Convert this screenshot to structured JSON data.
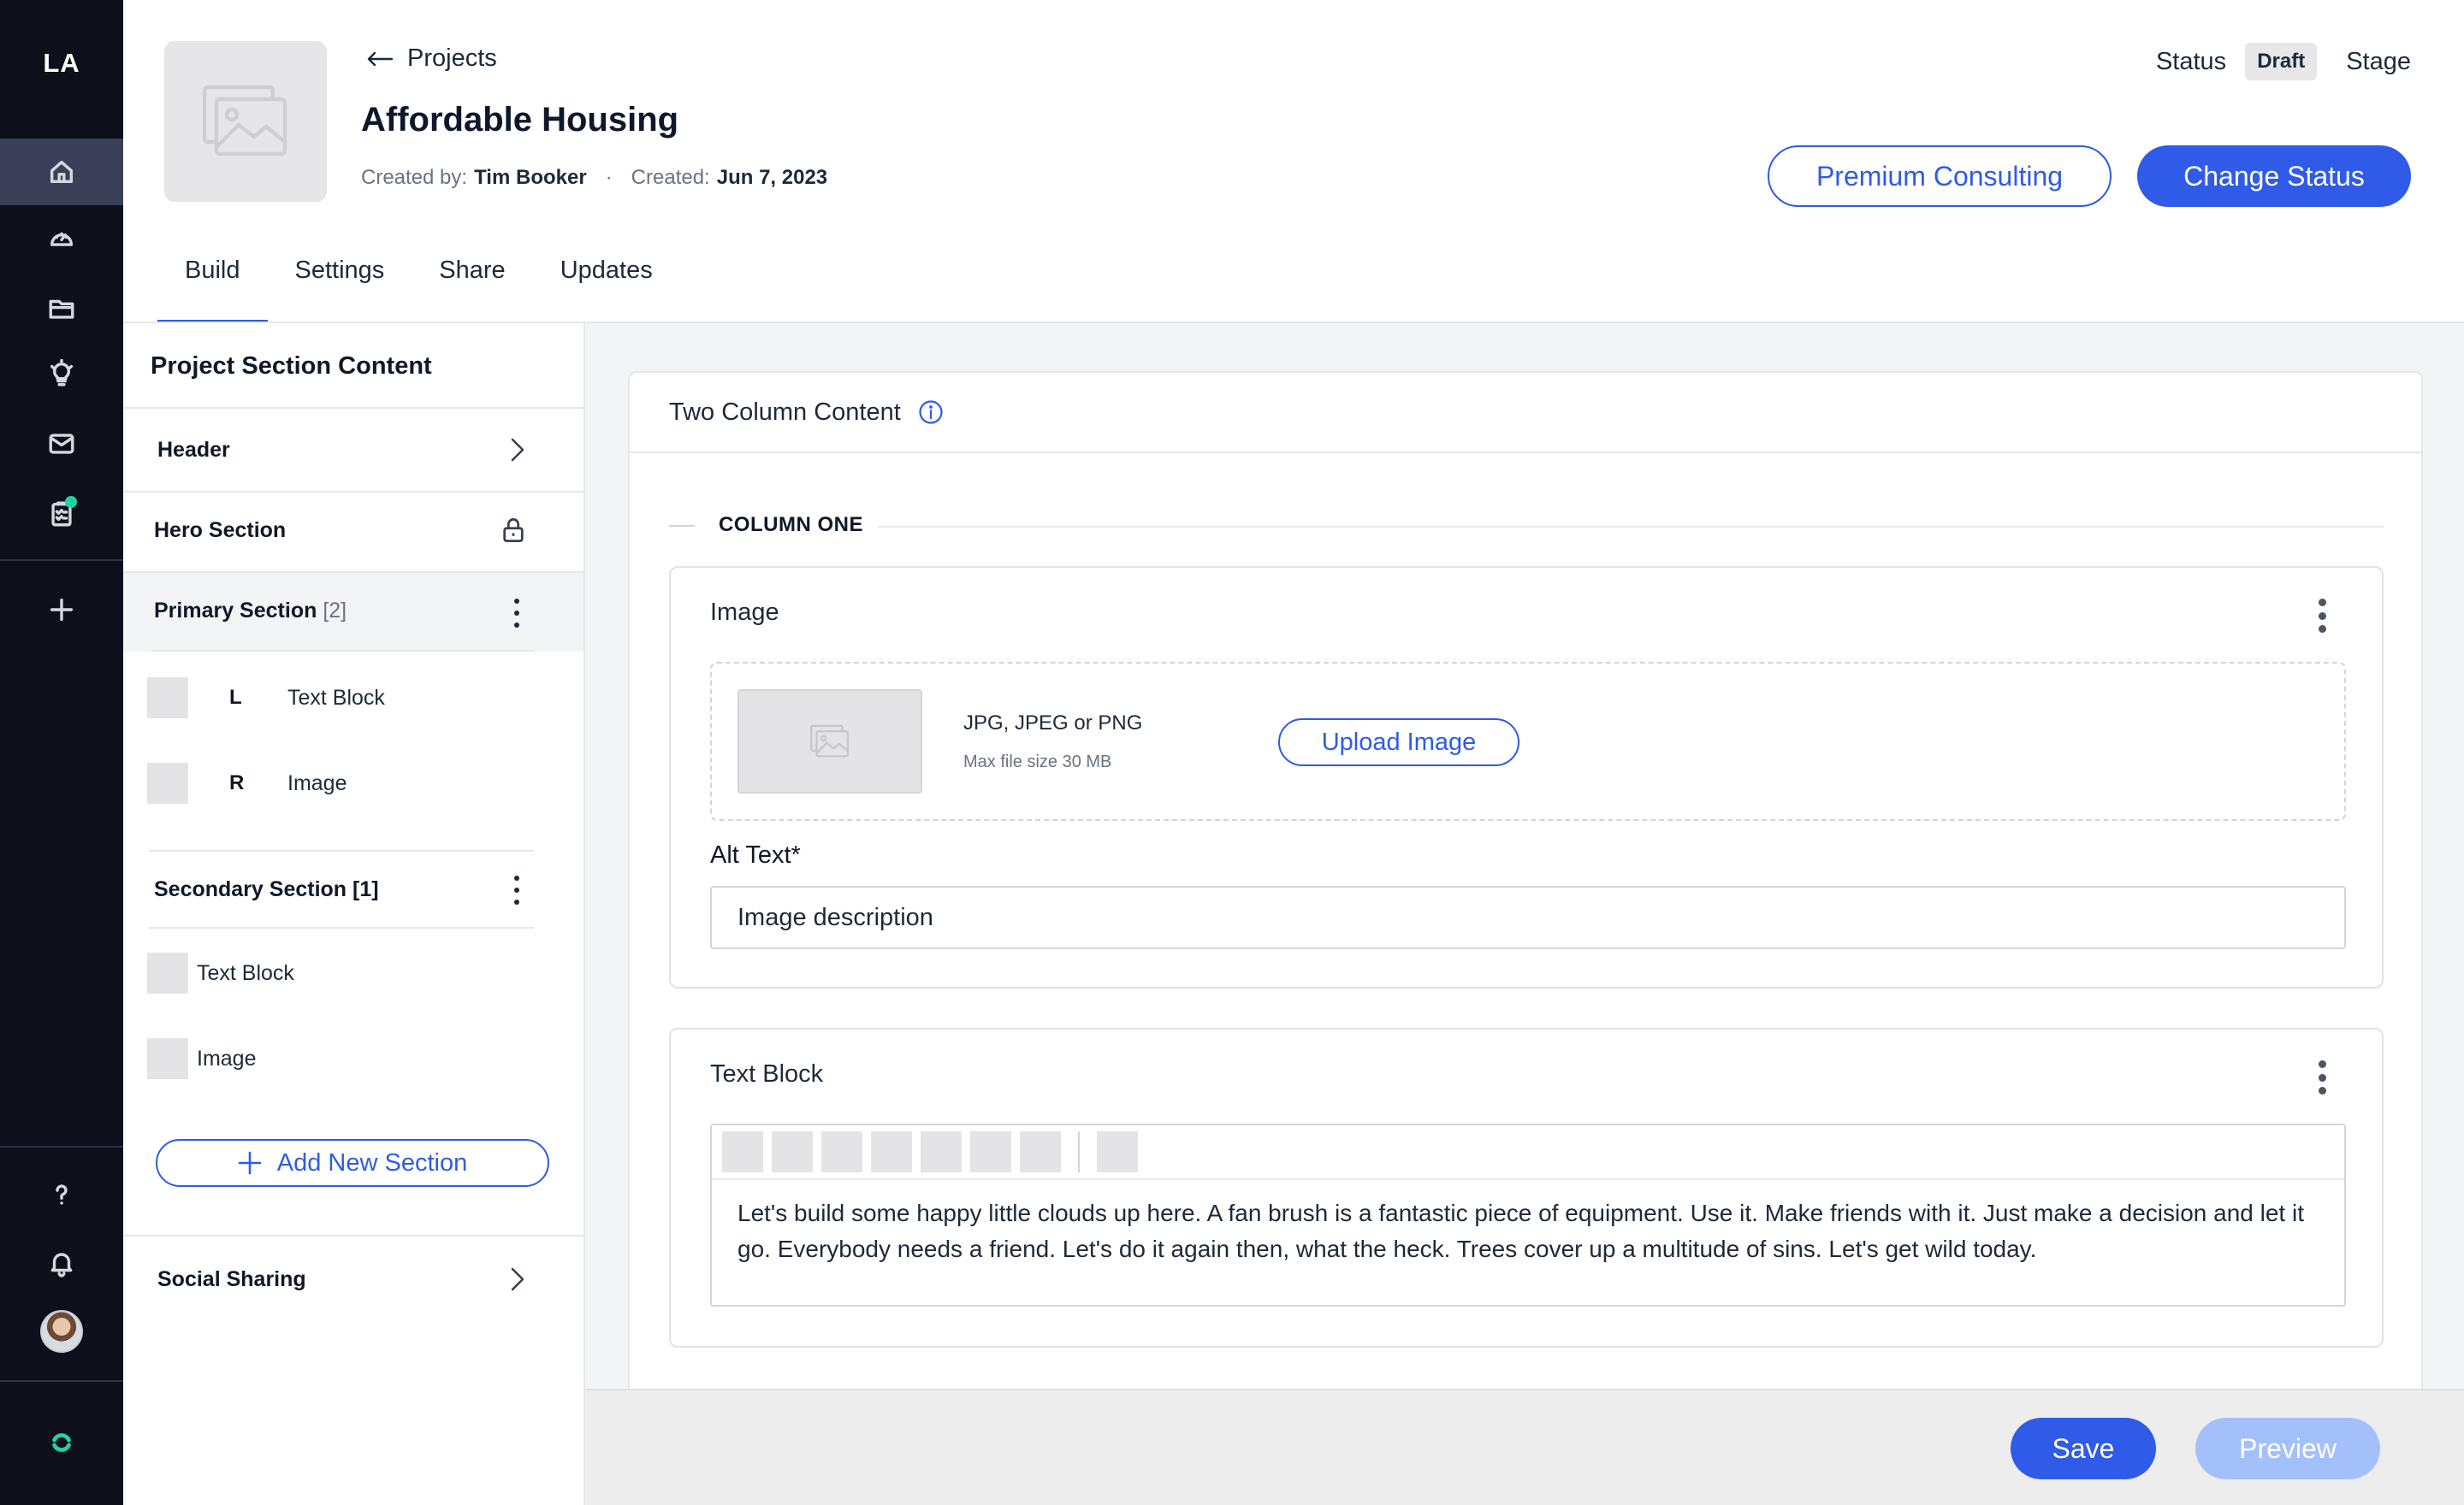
{
  "app": {
    "logo": "LA",
    "colors": {
      "accent": "#2f5be8",
      "accent_light": "#a4c0fb",
      "rail_bg": "#0d0f1a",
      "notify_dot": "#1fd1a3"
    }
  },
  "sidebar": {
    "items": [
      {
        "icon": "home-icon",
        "active": true
      },
      {
        "icon": "dashboard-gauge-icon",
        "active": false
      },
      {
        "icon": "folder-icon",
        "active": false
      },
      {
        "icon": "lightbulb-icon",
        "active": false
      },
      {
        "icon": "mail-icon",
        "active": false
      },
      {
        "icon": "clipboard-check-icon",
        "active": false,
        "has_notification": true
      },
      {
        "icon": "plus-icon",
        "active": false
      }
    ],
    "bottom": [
      {
        "icon": "help-icon"
      },
      {
        "icon": "bell-icon"
      },
      {
        "icon": "avatar"
      },
      {
        "icon": "brand-mark-icon"
      }
    ]
  },
  "header": {
    "back_label": "Projects",
    "title": "Affordable Housing",
    "created_by_label": "Created by:",
    "created_by": "Tim Booker",
    "created_label": "Created:",
    "created_date": "Jun 7, 2023",
    "status_label": "Status",
    "status_value": "Draft",
    "stage_label": "Stage",
    "premium_button": "Premium Consulting",
    "change_status_button": "Change Status"
  },
  "tabs": [
    {
      "label": "Build",
      "active": true
    },
    {
      "label": "Settings",
      "active": false
    },
    {
      "label": "Share",
      "active": false
    },
    {
      "label": "Updates",
      "active": false
    }
  ],
  "sections_panel": {
    "title": "Project Section Content",
    "header_label": "Header",
    "hero_label": "Hero Section",
    "primary_label": "Primary Section",
    "primary_count": "[2]",
    "primary_items": [
      {
        "slot": "L",
        "label": "Text Block"
      },
      {
        "slot": "R",
        "label": "Image"
      }
    ],
    "secondary_label": "Secondary Section [1]",
    "secondary_items": [
      {
        "label": "Text Block"
      },
      {
        "label": "Image"
      }
    ],
    "add_button": "Add New Section",
    "social_label": "Social Sharing"
  },
  "editor": {
    "card_title": "Two Column Content",
    "column_label": "COLUMN ONE",
    "image_card": {
      "title": "Image",
      "formats": "JPG, JPEG or PNG",
      "max_size": "Max file size 30 MB",
      "upload_button": "Upload Image",
      "alt_label": "Alt Text*",
      "alt_value": "Image description"
    },
    "text_card": {
      "title": "Text Block",
      "body": "Let's build some happy little clouds up here. A fan brush is a fantastic piece of equipment. Use it. Make friends with it. Just make a decision and let it go. Everybody needs a friend. Let's do it again then, what the heck. Trees cover up a multitude of sins. Let's get wild today."
    }
  },
  "footer": {
    "save_button": "Save",
    "preview_button": "Preview"
  }
}
